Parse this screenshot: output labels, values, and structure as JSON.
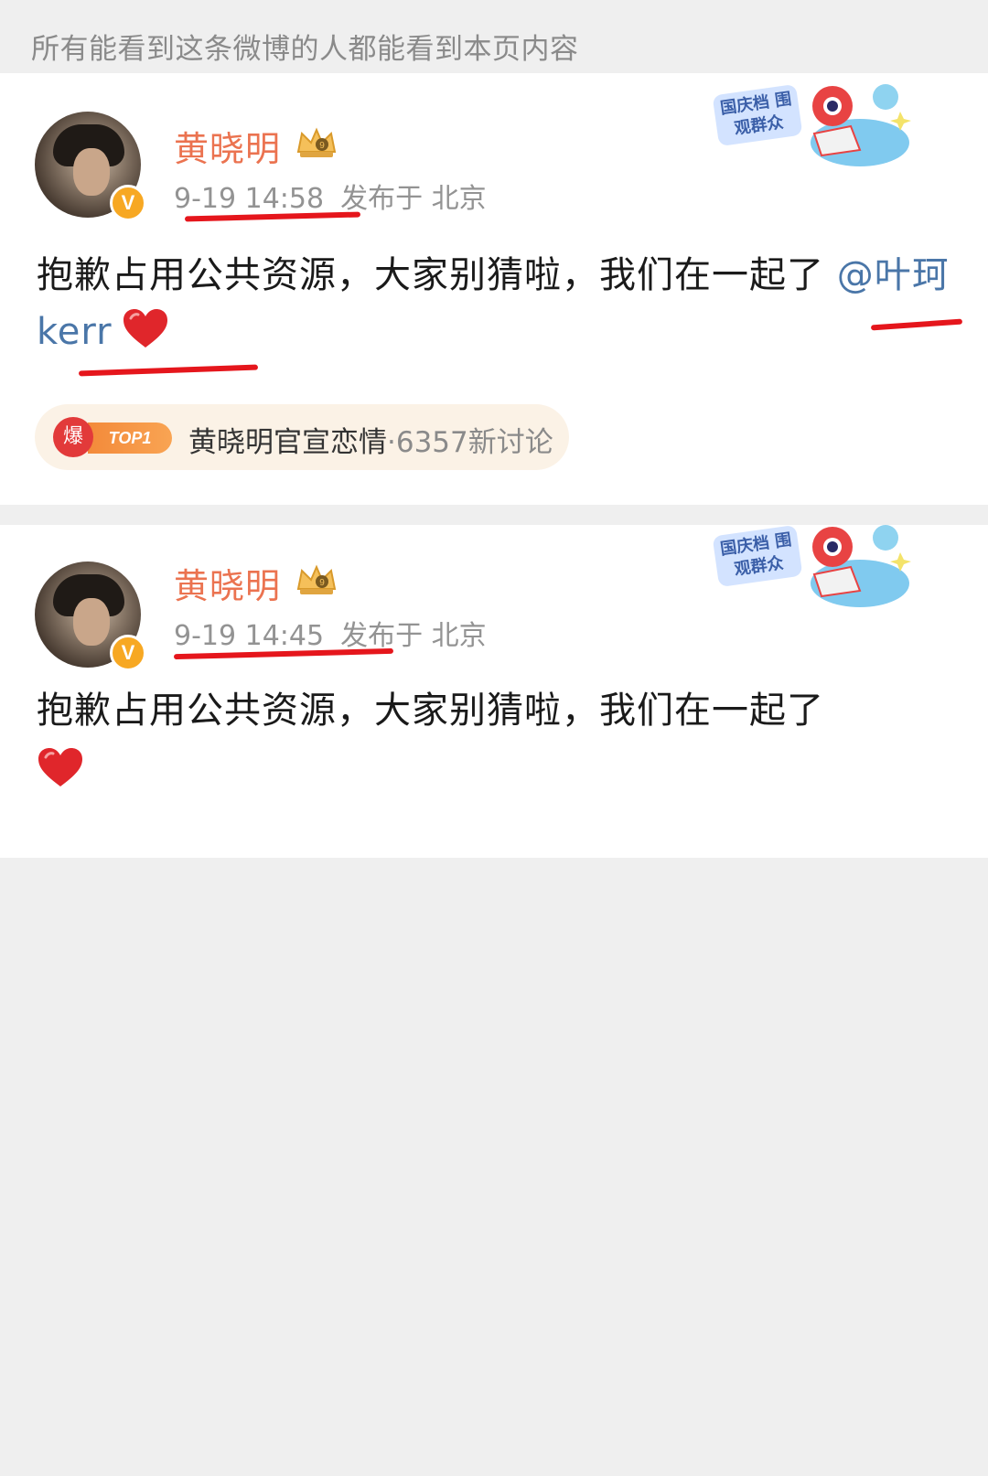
{
  "visibility_note": "所有能看到这条微博的人都能看到本页内容",
  "posts": [
    {
      "username": "黄晓明",
      "time": "9-19 14:58",
      "location": "发布于 北京",
      "body_text": "抱歉占用公共资源，大家别猜啦，我们在一起了",
      "mention": "@叶珂 kerr",
      "sticker_label": "国庆档 围观群众",
      "trend": {
        "badge": "爆",
        "rank": "TOP1",
        "title": "黄晓明官宣恋情",
        "count": "·6357新讨论"
      }
    },
    {
      "username": "黄晓明",
      "time": "9-19 14:45",
      "location": "发布于 北京",
      "body_text": "抱歉占用公共资源，大家别猜啦，我们在一起了",
      "sticker_label": "国庆档 围观群众"
    }
  ],
  "colors": {
    "username": "#eb7350",
    "mention": "#4a76a8",
    "annotation": "#e5161c",
    "meta": "#939393"
  },
  "icons": [
    "verified-v-icon",
    "crown-icon",
    "heart-icon",
    "sticker-icon"
  ]
}
